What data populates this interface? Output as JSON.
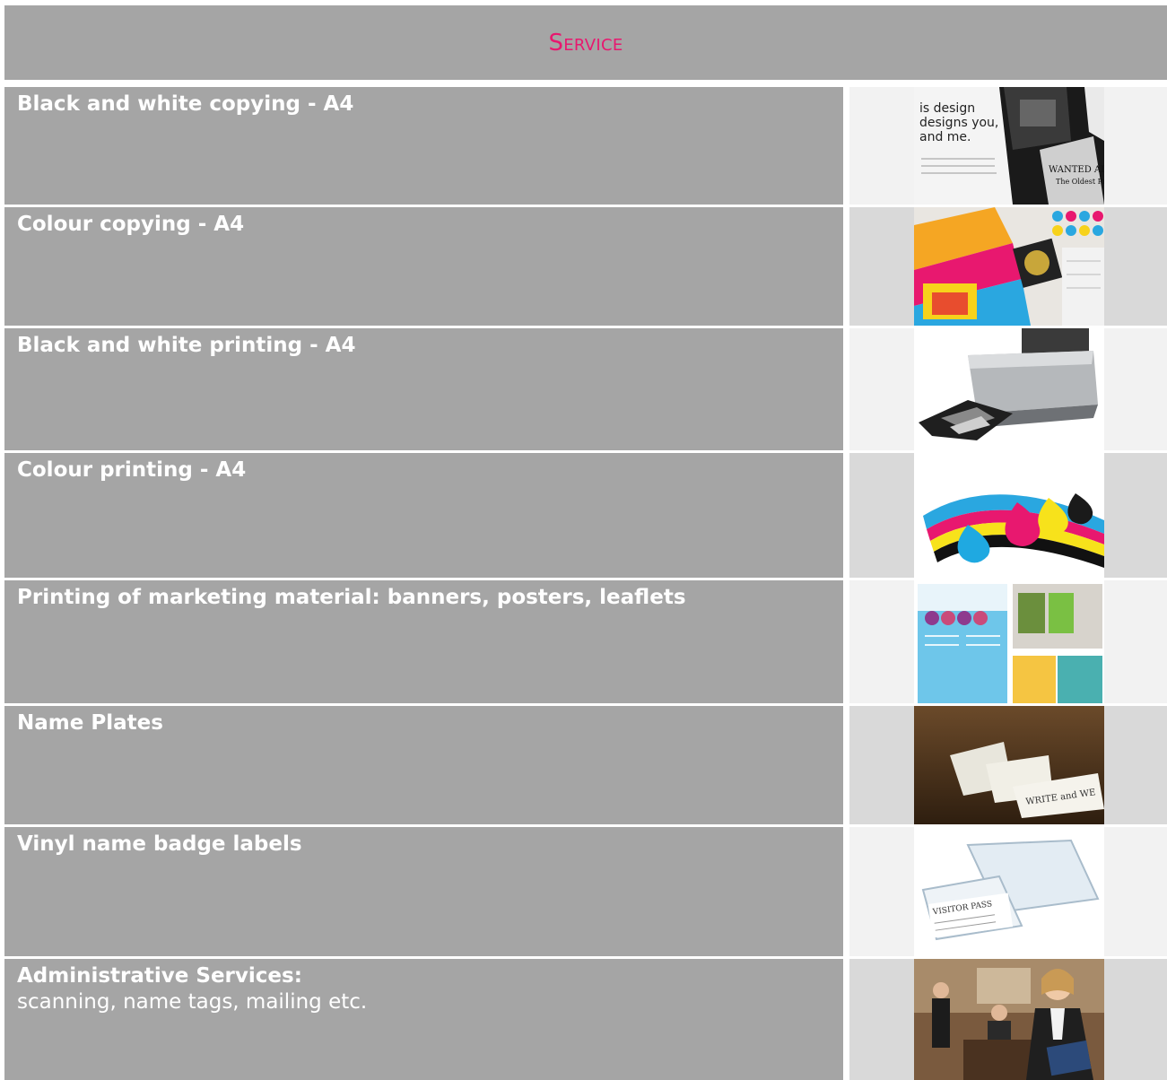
{
  "header": {
    "title": "Service"
  },
  "services": [
    {
      "title": "Black and white copying - A4",
      "description": "",
      "image_icon": "bw-print-collage-icon"
    },
    {
      "title": "Colour copying - A4",
      "description": "",
      "image_icon": "color-swatches-icon"
    },
    {
      "title": "Black and white printing - A4",
      "description": "",
      "image_icon": "printer-icon"
    },
    {
      "title": "Colour printing - A4",
      "description": "",
      "image_icon": "cmyk-ink-drops-icon"
    },
    {
      "title": "Printing of marketing material: banners, posters, leaflets",
      "description": "",
      "image_icon": "posters-icon"
    },
    {
      "title": "Name Plates",
      "description": "",
      "image_icon": "name-plates-icon"
    },
    {
      "title": "Vinyl name badge labels",
      "description": "",
      "image_icon": "badge-holder-icon"
    },
    {
      "title": "Administrative Services:",
      "description": "scanning, name tags, mailing etc.",
      "image_icon": "office-staff-icon"
    }
  ],
  "colors": {
    "accent": "#e8186f",
    "header_bg": "#a5a5a5",
    "row_bg": "#a5a5a5"
  }
}
